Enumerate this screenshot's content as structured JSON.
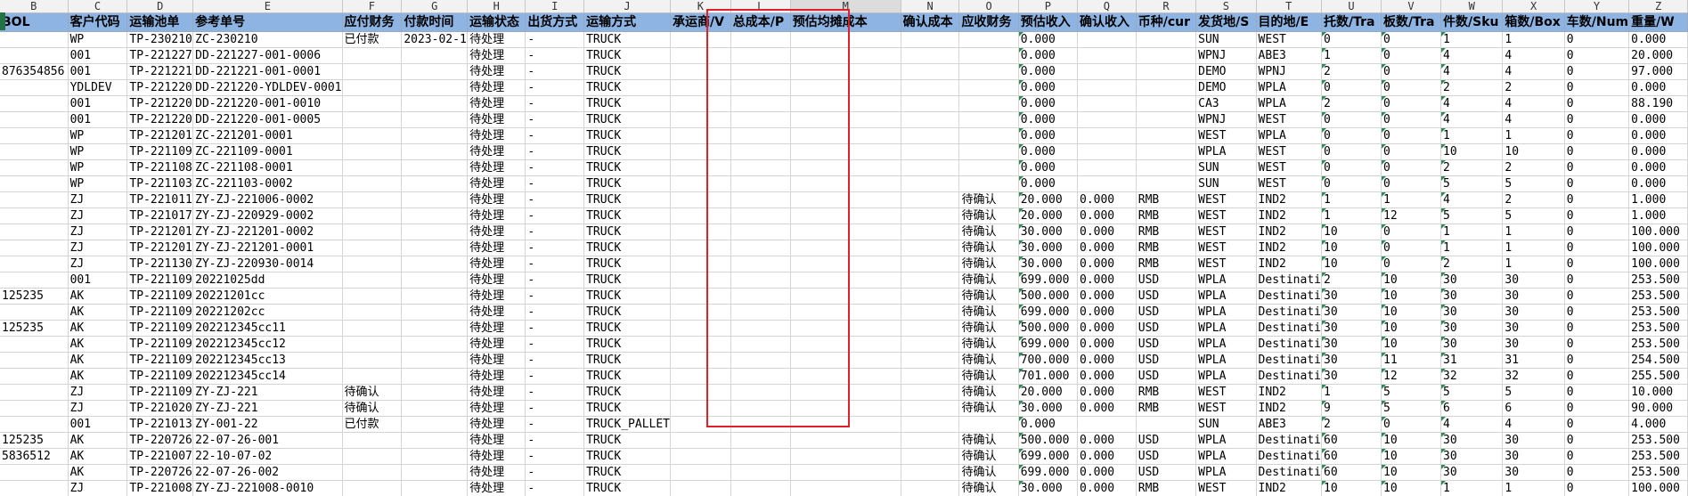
{
  "columns": [
    {
      "letter": "B",
      "width": 79
    },
    {
      "letter": "C",
      "width": 74
    },
    {
      "letter": "D",
      "width": 74
    },
    {
      "letter": "E",
      "width": 74
    },
    {
      "letter": "F",
      "width": 74
    },
    {
      "letter": "G",
      "width": 74
    },
    {
      "letter": "H",
      "width": 71
    },
    {
      "letter": "I",
      "width": 72
    },
    {
      "letter": "J",
      "width": 73
    },
    {
      "letter": "K",
      "width": 74
    },
    {
      "letter": "L",
      "width": 73
    },
    {
      "letter": "M",
      "width": 158
    },
    {
      "letter": "N",
      "width": 72
    },
    {
      "letter": "O",
      "width": 73
    },
    {
      "letter": "P",
      "width": 73
    },
    {
      "letter": "Q",
      "width": 72
    },
    {
      "letter": "R",
      "width": 73
    },
    {
      "letter": "S",
      "width": 74
    },
    {
      "letter": "T",
      "width": 73
    },
    {
      "letter": "U",
      "width": 73
    },
    {
      "letter": "V",
      "width": 73
    },
    {
      "letter": "W",
      "width": 73
    },
    {
      "letter": "X",
      "width": 73
    },
    {
      "letter": "Y",
      "width": 72
    },
    {
      "letter": "Z",
      "width": 73
    }
  ],
  "header": [
    "BOL",
    "客户代码",
    "运输池单",
    "参考单号",
    "应付财务",
    "付款时间",
    "运输状态",
    "出货方式",
    "运输方式",
    "承运商/V",
    "总成本/P",
    "预估均摊成本",
    "确认成本",
    "应收财务",
    "预估收入",
    "确认收入",
    "币种/cur",
    "发货地/S",
    "目的地/E",
    "托数/Tra",
    "板数/Tra",
    "件数/Sku",
    "箱数/Box",
    "车数/Num",
    "重量/W"
  ],
  "rows": [
    [
      "",
      "WP",
      "TP-230210",
      "ZC-230210",
      "已付款",
      "2023-02-1",
      "待处理",
      "-",
      "TRUCK",
      "",
      "",
      "",
      "",
      "",
      "0.000",
      "",
      "",
      "SUN",
      "WEST",
      "0",
      "0",
      "1",
      "1",
      "0",
      "0.000"
    ],
    [
      "",
      "001",
      "TP-221227",
      "DD-221227-001-0006",
      "",
      "",
      "待处理",
      "-",
      "TRUCK",
      "",
      "",
      "",
      "",
      "",
      "0.000",
      "",
      "",
      "WPNJ",
      "ABE3",
      "1",
      "0",
      "4",
      "4",
      "0",
      "20.000"
    ],
    [
      "876354856",
      "001",
      "TP-221221",
      "DD-221221-001-0001",
      "",
      "",
      "待处理",
      "-",
      "TRUCK",
      "",
      "",
      "",
      "",
      "",
      "0.000",
      "",
      "",
      "DEMO",
      "WPNJ",
      "2",
      "0",
      "4",
      "4",
      "0",
      "97.000"
    ],
    [
      "",
      "YDLDEV",
      "TP-221220",
      "DD-221220-YDLDEV-0001",
      "",
      "",
      "待处理",
      "-",
      "TRUCK",
      "",
      "",
      "",
      "",
      "",
      "0.000",
      "",
      "",
      "DEMO",
      "WPLA",
      "0",
      "0",
      "2",
      "2",
      "0",
      "0.000"
    ],
    [
      "",
      "001",
      "TP-221220",
      "DD-221220-001-0010",
      "",
      "",
      "待处理",
      "-",
      "TRUCK",
      "",
      "",
      "",
      "",
      "",
      "0.000",
      "",
      "",
      "CA3",
      "WPLA",
      "2",
      "0",
      "4",
      "4",
      "0",
      "88.190"
    ],
    [
      "",
      "001",
      "TP-221220",
      "DD-221220-001-0005",
      "",
      "",
      "待处理",
      "-",
      "TRUCK",
      "",
      "",
      "",
      "",
      "",
      "0.000",
      "",
      "",
      "WPNJ",
      "WEST",
      "0",
      "0",
      "4",
      "4",
      "0",
      "0.000"
    ],
    [
      "",
      "WP",
      "TP-221201",
      "ZC-221201-0001",
      "",
      "",
      "待处理",
      "-",
      "TRUCK",
      "",
      "",
      "",
      "",
      "",
      "0.000",
      "",
      "",
      "WEST",
      "WPLA",
      "0",
      "0",
      "1",
      "1",
      "0",
      "0.000"
    ],
    [
      "",
      "WP",
      "TP-221109",
      "ZC-221109-0001",
      "",
      "",
      "待处理",
      "-",
      "TRUCK",
      "",
      "",
      "",
      "",
      "",
      "0.000",
      "",
      "",
      "WPLA",
      "WEST",
      "0",
      "0",
      "10",
      "10",
      "0",
      "0.000"
    ],
    [
      "",
      "WP",
      "TP-221108",
      "ZC-221108-0001",
      "",
      "",
      "待处理",
      "-",
      "TRUCK",
      "",
      "",
      "",
      "",
      "",
      "0.000",
      "",
      "",
      "SUN",
      "WEST",
      "0",
      "0",
      "2",
      "2",
      "0",
      "0.000"
    ],
    [
      "",
      "WP",
      "TP-221103",
      "ZC-221103-0002",
      "",
      "",
      "待处理",
      "-",
      "TRUCK",
      "",
      "",
      "",
      "",
      "",
      "0.000",
      "",
      "",
      "SUN",
      "WEST",
      "0",
      "0",
      "5",
      "5",
      "0",
      "0.000"
    ],
    [
      "",
      "ZJ",
      "TP-221011",
      "ZY-ZJ-221006-0002",
      "",
      "",
      "待处理",
      "-",
      "TRUCK",
      "",
      "",
      "",
      "",
      "待确认",
      "20.000",
      "0.000",
      "RMB",
      "WEST",
      "IND2",
      "1",
      "1",
      "4",
      "2",
      "0",
      "1.000"
    ],
    [
      "",
      "ZJ",
      "TP-221017",
      "ZY-ZJ-220929-0002",
      "",
      "",
      "待处理",
      "-",
      "TRUCK",
      "",
      "",
      "",
      "",
      "待确认",
      "20.000",
      "0.000",
      "RMB",
      "WEST",
      "IND2",
      "1",
      "12",
      "5",
      "5",
      "0",
      "1.000"
    ],
    [
      "",
      "ZJ",
      "TP-221201",
      "ZY-ZJ-221201-0002",
      "",
      "",
      "待处理",
      "-",
      "TRUCK",
      "",
      "",
      "",
      "",
      "待确认",
      "30.000",
      "0.000",
      "RMB",
      "WEST",
      "IND2",
      "10",
      "0",
      "1",
      "1",
      "0",
      "100.000"
    ],
    [
      "",
      "ZJ",
      "TP-221201",
      "ZY-ZJ-221201-0001",
      "",
      "",
      "待处理",
      "-",
      "TRUCK",
      "",
      "",
      "",
      "",
      "待确认",
      "30.000",
      "0.000",
      "RMB",
      "WEST",
      "IND2",
      "10",
      "0",
      "1",
      "1",
      "0",
      "100.000"
    ],
    [
      "",
      "ZJ",
      "TP-221130",
      "ZY-ZJ-220930-0014",
      "",
      "",
      "待处理",
      "-",
      "TRUCK",
      "",
      "",
      "",
      "",
      "待确认",
      "30.000",
      "0.000",
      "RMB",
      "WEST",
      "IND2",
      "10",
      "0",
      "2",
      "1",
      "0",
      "100.000"
    ],
    [
      "",
      "001",
      "TP-221109",
      "20221025dd",
      "",
      "",
      "待处理",
      "-",
      "TRUCK",
      "",
      "",
      "",
      "",
      "待确认",
      "699.000",
      "0.000",
      "USD",
      "WPLA",
      "Destinati",
      "2",
      "10",
      "30",
      "30",
      "0",
      "253.500"
    ],
    [
      "125235",
      "AK",
      "TP-221109",
      "20221201cc",
      "",
      "",
      "待处理",
      "-",
      "TRUCK",
      "",
      "",
      "",
      "",
      "待确认",
      "500.000",
      "0.000",
      "USD",
      "WPLA",
      "Destinati",
      "30",
      "10",
      "30",
      "30",
      "0",
      "253.500"
    ],
    [
      "",
      "AK",
      "TP-221109",
      "20221202cc",
      "",
      "",
      "待处理",
      "-",
      "TRUCK",
      "",
      "",
      "",
      "",
      "待确认",
      "699.000",
      "0.000",
      "USD",
      "WPLA",
      "Destinati",
      "30",
      "10",
      "30",
      "30",
      "0",
      "253.500"
    ],
    [
      "125235",
      "AK",
      "TP-221109",
      "202212345cc11",
      "",
      "",
      "待处理",
      "-",
      "TRUCK",
      "",
      "",
      "",
      "",
      "待确认",
      "500.000",
      "0.000",
      "USD",
      "WPLA",
      "Destinati",
      "30",
      "10",
      "30",
      "30",
      "0",
      "253.500"
    ],
    [
      "",
      "AK",
      "TP-221109",
      "202212345cc12",
      "",
      "",
      "待处理",
      "-",
      "TRUCK",
      "",
      "",
      "",
      "",
      "待确认",
      "699.000",
      "0.000",
      "USD",
      "WPLA",
      "Destinati",
      "30",
      "10",
      "30",
      "30",
      "0",
      "253.500"
    ],
    [
      "",
      "AK",
      "TP-221109",
      "202212345cc13",
      "",
      "",
      "待处理",
      "-",
      "TRUCK",
      "",
      "",
      "",
      "",
      "待确认",
      "700.000",
      "0.000",
      "USD",
      "WPLA",
      "Destinati",
      "30",
      "11",
      "31",
      "31",
      "0",
      "254.500"
    ],
    [
      "",
      "AK",
      "TP-221109",
      "202212345cc14",
      "",
      "",
      "待处理",
      "-",
      "TRUCK",
      "",
      "",
      "",
      "",
      "待确认",
      "701.000",
      "0.000",
      "USD",
      "WPLA",
      "Destinati",
      "30",
      "12",
      "32",
      "32",
      "0",
      "255.500"
    ],
    [
      "",
      "ZJ",
      "TP-221109",
      "ZY-ZJ-221",
      "待确认",
      "",
      "待处理",
      "-",
      "TRUCK",
      "",
      "",
      "",
      "",
      "待确认",
      "20.000",
      "0.000",
      "RMB",
      "WEST",
      "IND2",
      "1",
      "5",
      "5",
      "5",
      "0",
      "10.000"
    ],
    [
      "",
      "ZJ",
      "TP-221020",
      "ZY-ZJ-221",
      "待确认",
      "",
      "待处理",
      "-",
      "TRUCK",
      "",
      "",
      "",
      "",
      "待确认",
      "30.000",
      "0.000",
      "RMB",
      "WEST",
      "IND2",
      "9",
      "5",
      "6",
      "6",
      "0",
      "90.000"
    ],
    [
      "",
      "001",
      "TP-221013",
      "ZY-001-22",
      "已付款",
      "",
      "待处理",
      "-",
      "TRUCK_PALLET",
      "",
      "",
      "",
      "",
      "",
      "0.000",
      "",
      "",
      "SUN",
      "ABE3",
      "2",
      "0",
      "4",
      "4",
      "0",
      "4.000"
    ],
    [
      "125235",
      "AK",
      "TP-220726",
      "22-07-26-001",
      "",
      "",
      "待处理",
      "-",
      "TRUCK",
      "",
      "",
      "",
      "",
      "待确认",
      "500.000",
      "0.000",
      "USD",
      "WPLA",
      "Destinati",
      "60",
      "10",
      "30",
      "30",
      "0",
      "253.500"
    ],
    [
      "5836512",
      "AK",
      "TP-221007",
      "22-10-07-02",
      "",
      "",
      "待处理",
      "-",
      "TRUCK",
      "",
      "",
      "",
      "",
      "待确认",
      "699.000",
      "0.000",
      "USD",
      "WPLA",
      "Destinati",
      "60",
      "10",
      "30",
      "30",
      "0",
      "253.500"
    ],
    [
      "",
      "AK",
      "TP-220726",
      "22-07-26-002",
      "",
      "",
      "待处理",
      "-",
      "TRUCK",
      "",
      "",
      "",
      "",
      "待确认",
      "699.000",
      "0.000",
      "USD",
      "WPLA",
      "Destinati",
      "60",
      "10",
      "30",
      "30",
      "0",
      "253.500"
    ],
    [
      "",
      "ZJ",
      "TP-221008",
      "ZY-ZJ-221008-0010",
      "",
      "",
      "待处理",
      "-",
      "TRUCK",
      "",
      "",
      "",
      "",
      "待确认",
      "30.000",
      "0.000",
      "RMB",
      "WEST",
      "IND2",
      "10",
      "10",
      "1",
      "1",
      "0",
      "100.000"
    ]
  ]
}
